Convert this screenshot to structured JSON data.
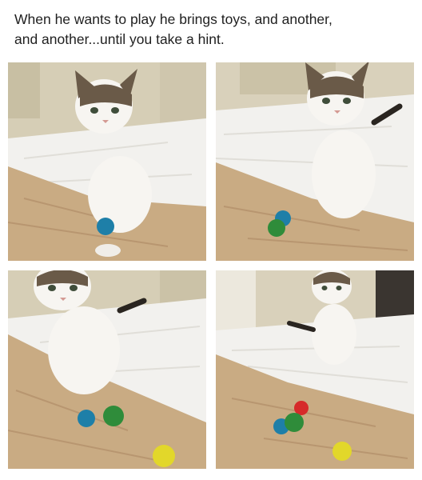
{
  "caption": {
    "line1": "When he wants to play he brings toys, and another,",
    "line2": "and another...until you take a hint."
  },
  "photos": [
    {
      "toy_colors": [
        "#1e7fa8"
      ]
    },
    {
      "toy_colors": [
        "#1e7fa8",
        "#2f8c3a"
      ]
    },
    {
      "toy_colors": [
        "#1e7fa8",
        "#2f8c3a",
        "#e2d72a"
      ]
    },
    {
      "toy_colors": [
        "#1e7fa8",
        "#2f8c3a",
        "#e2d72a",
        "#d62a2a"
      ]
    }
  ],
  "colors": {
    "sheet": "#f2f1ee",
    "blanket": "#c9ab83",
    "wall": "#d9d1bb",
    "cat_white": "#f7f5f1",
    "cat_tabby": "#6a5a48"
  }
}
